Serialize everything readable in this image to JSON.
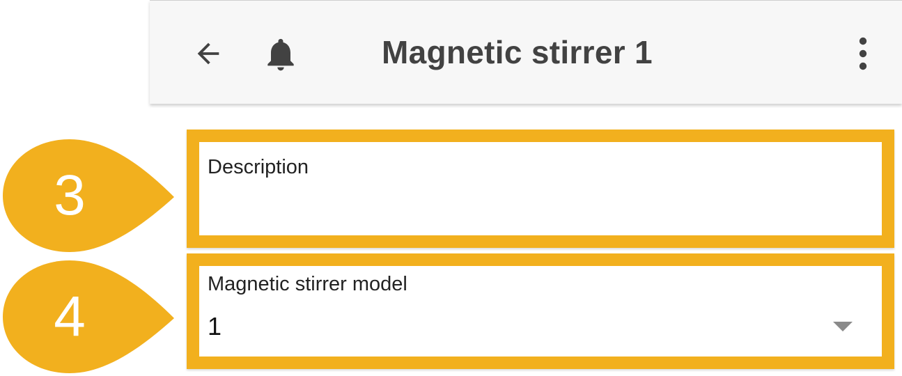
{
  "appbar": {
    "title": "Magnetic stirrer 1",
    "back_icon": "arrow-left-icon",
    "notification_icon": "bell-icon",
    "menu_icon": "more-vertical-icon",
    "background": "#f7f7f7",
    "title_color": "#424242"
  },
  "callouts": [
    {
      "number": "3"
    },
    {
      "number": "4"
    }
  ],
  "form": {
    "description": {
      "label": "Description",
      "value": ""
    },
    "model": {
      "label": "Magnetic stirrer model",
      "value": "1"
    }
  },
  "colors": {
    "highlight": "#f2b01e",
    "callout_text": "#ffffff"
  }
}
